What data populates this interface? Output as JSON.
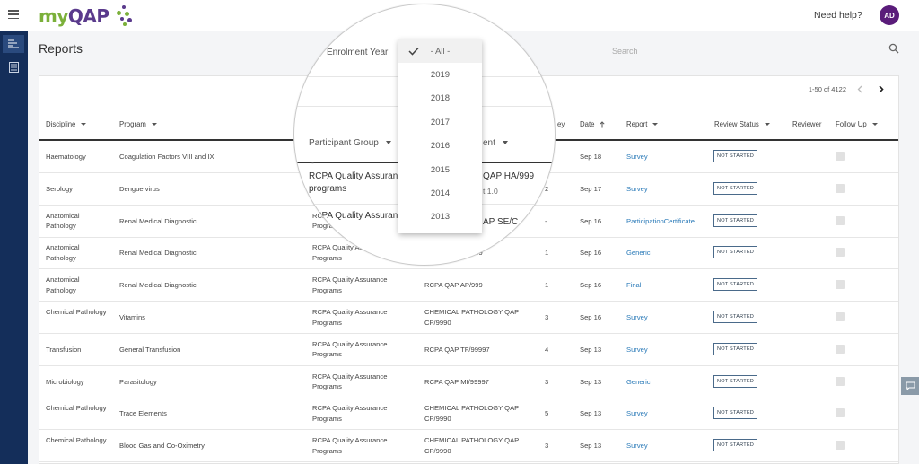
{
  "app": {
    "logo_my": "my",
    "logo_qap": "QAP",
    "help": "Need help?",
    "avatar": "AD"
  },
  "page": {
    "title": "Reports",
    "search_placeholder": "Search"
  },
  "pager": {
    "range": "1-50 of 4122"
  },
  "columns": {
    "discipline": "Discipline",
    "program": "Program",
    "survey": "ey",
    "date": "Date",
    "report": "Report",
    "review_status": "Review Status",
    "reviewer": "Reviewer",
    "follow_up": "Follow Up"
  },
  "rows": [
    {
      "discipline": "Haematology",
      "program": "Coagulation Factors VIII and IX",
      "group": "",
      "enrolment": "",
      "survey": "",
      "date": "Sep 18",
      "report": "Survey",
      "status": "NOT STARTED"
    },
    {
      "discipline": "Serology",
      "program": "Dengue virus",
      "group": "",
      "enrolment": "",
      "survey": "2",
      "date": "Sep 17",
      "report": "Survey",
      "status": "NOT STARTED"
    },
    {
      "discipline": "Anatomical Pathology",
      "program": "Renal Medical Diagnostic",
      "group": "RCPA Quality Assurance Programs",
      "enrolment": "RCPA QAP SE/CP/999",
      "survey": "-",
      "date": "Sep 16",
      "report": "ParticipationCertificate",
      "status": "NOT STARTED"
    },
    {
      "discipline": "Anatomical Pathology",
      "program": "Renal Medical Diagnostic",
      "group": "RCPA Quality Assurance Programs",
      "enrolment": "RCPA QAP AP/999",
      "survey": "1",
      "date": "Sep 16",
      "report": "Generic",
      "status": "NOT STARTED"
    },
    {
      "discipline": "Anatomical Pathology",
      "program": "Renal Medical Diagnostic",
      "group": "RCPA Quality Assurance Programs",
      "enrolment": "RCPA QAP AP/999",
      "survey": "1",
      "date": "Sep 16",
      "report": "Final",
      "status": "NOT STARTED"
    },
    {
      "discipline": "Chemical Pathology",
      "program": "Vitamins",
      "group": "RCPA Quality Assurance Programs",
      "enrolment": "CHEMICAL PATHOLOGY QAP CP/9990",
      "survey": "3",
      "date": "Sep 16",
      "report": "Survey",
      "status": "NOT STARTED"
    },
    {
      "discipline": "Transfusion",
      "program": "General Transfusion",
      "group": "RCPA Quality Assurance Programs",
      "enrolment": "RCPA QAP TF/99997",
      "survey": "4",
      "date": "Sep 13",
      "report": "Survey",
      "status": "NOT STARTED"
    },
    {
      "discipline": "Microbiology",
      "program": "Parasitology",
      "group": "RCPA Quality Assurance Programs",
      "enrolment": "RCPA QAP MI/99997",
      "survey": "3",
      "date": "Sep 13",
      "report": "Generic",
      "status": "NOT STARTED"
    },
    {
      "discipline": "Chemical Pathology",
      "program": "Trace Elements",
      "group": "RCPA Quality Assurance Programs",
      "enrolment": "CHEMICAL PATHOLOGY QAP CP/9990",
      "survey": "5",
      "date": "Sep 13",
      "report": "Survey",
      "status": "NOT STARTED"
    },
    {
      "discipline": "Chemical Pathology",
      "program": "Blood Gas and Co-Oximetry",
      "group": "RCPA Quality Assurance Programs",
      "enrolment": "CHEMICAL PATHOLOGY QAP CP/9990",
      "survey": "3",
      "date": "Sep 13",
      "report": "Survey",
      "status": "NOT STARTED"
    }
  ],
  "magnifier": {
    "filter_label": "Enrolment Year",
    "participant_group": "Participant Group",
    "enrolment_header": "ent",
    "dash": "-",
    "group_line1": "RCPA Quality Assurance",
    "group_line2": "programs",
    "enrol_line1": "QAP HA/999",
    "enrol_line2": "t 1.0",
    "row3_group": "RCPA Quality Assurance",
    "row3_enrol": "AP SE/C"
  },
  "dropdown": {
    "options": [
      "- All -",
      "2019",
      "2018",
      "2017",
      "2016",
      "2015",
      "2014",
      "2013"
    ],
    "selected": "- All -"
  },
  "colors": {
    "link": "#2a7ab8",
    "rail": "#142e5a",
    "avatar": "#5a1c7a",
    "logo_green": "#7bb03a",
    "logo_purple": "#5a3a8c"
  }
}
